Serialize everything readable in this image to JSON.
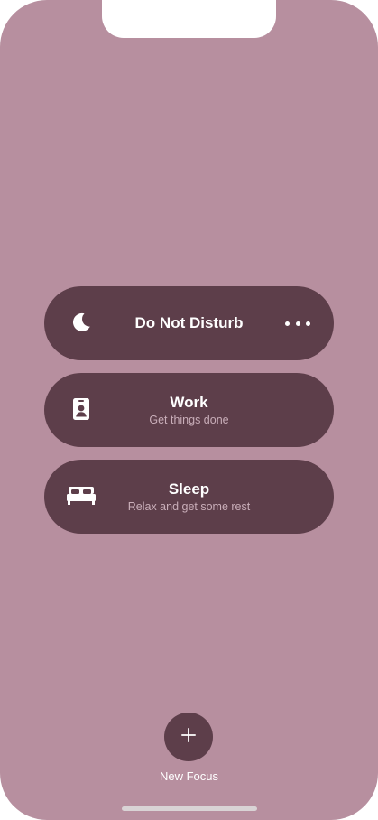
{
  "focus_modes": [
    {
      "title": "Do Not Disturb",
      "subtitle": "",
      "icon": "moon-icon"
    },
    {
      "title": "Work",
      "subtitle": "Get things done",
      "icon": "id-badge-icon"
    },
    {
      "title": "Sleep",
      "subtitle": "Relax and get some rest",
      "icon": "bed-icon"
    }
  ],
  "new_focus": {
    "label": "New Focus",
    "icon": "plus-icon"
  },
  "colors": {
    "background": "#b78f9f",
    "card": "#5d3e4a",
    "subtitle": "#c9aeb9",
    "text": "#ffffff"
  }
}
